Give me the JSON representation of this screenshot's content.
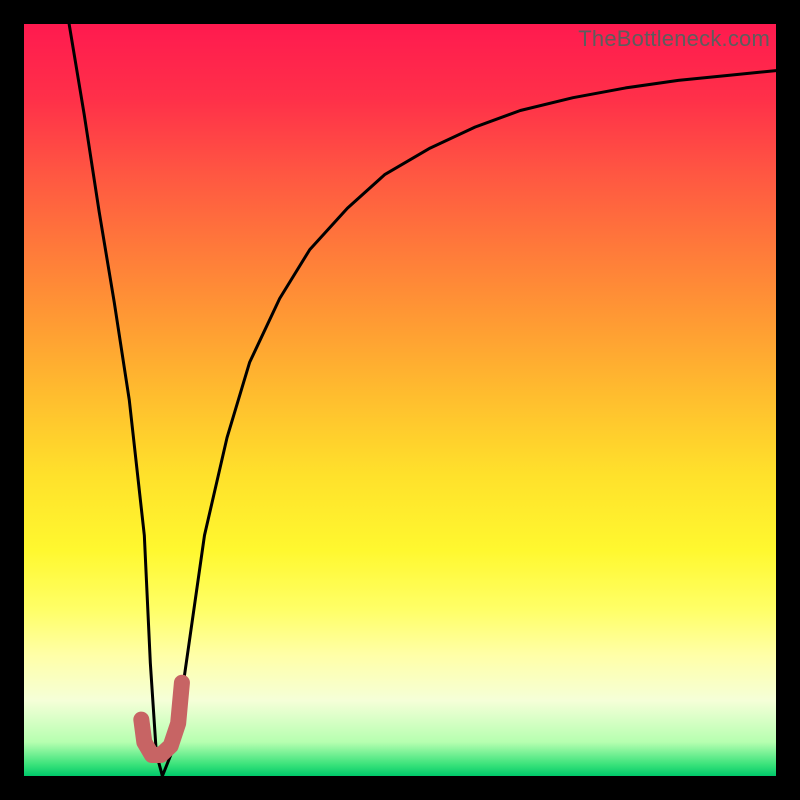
{
  "watermark": "TheBottleneck.com",
  "colors": {
    "frame": "#000000",
    "curve": "#000000",
    "marker": "#c76464",
    "gradient_stops": [
      {
        "o": 0.0,
        "c": "#ff1a4f"
      },
      {
        "o": 0.1,
        "c": "#ff3049"
      },
      {
        "o": 0.2,
        "c": "#ff5742"
      },
      {
        "o": 0.3,
        "c": "#ff7a3a"
      },
      {
        "o": 0.4,
        "c": "#ff9c33"
      },
      {
        "o": 0.5,
        "c": "#ffbf2e"
      },
      {
        "o": 0.6,
        "c": "#ffe12b"
      },
      {
        "o": 0.7,
        "c": "#fff82f"
      },
      {
        "o": 0.78,
        "c": "#ffff68"
      },
      {
        "o": 0.84,
        "c": "#ffffa8"
      },
      {
        "o": 0.9,
        "c": "#f5ffd8"
      },
      {
        "o": 0.955,
        "c": "#b6ffb0"
      },
      {
        "o": 0.985,
        "c": "#39e27a"
      },
      {
        "o": 1.0,
        "c": "#00c86a"
      }
    ]
  },
  "chart_data": {
    "type": "line",
    "title": "",
    "xlabel": "",
    "ylabel": "",
    "xlim": [
      0,
      100
    ],
    "ylim": [
      0,
      100
    ],
    "grid": false,
    "legend": false,
    "series": [
      {
        "name": "bottleneck-curve",
        "x": [
          6,
          8,
          10,
          12,
          14,
          16,
          16.8,
          17.6,
          18.4,
          20,
          22,
          24,
          27,
          30,
          34,
          38,
          43,
          48,
          54,
          60,
          66,
          73,
          80,
          87,
          94,
          100
        ],
        "y": [
          100,
          88,
          75,
          63,
          50,
          32,
          15,
          3,
          0,
          4,
          18,
          32,
          45,
          55,
          63.5,
          70,
          75.5,
          80,
          83.5,
          86.3,
          88.5,
          90.2,
          91.5,
          92.5,
          93.2,
          93.8
        ]
      }
    ],
    "marker": {
      "name": "optimum-j",
      "points": [
        {
          "x": 15.6,
          "y": 7.5
        },
        {
          "x": 16.0,
          "y": 4.5
        },
        {
          "x": 17.0,
          "y": 2.8
        },
        {
          "x": 18.2,
          "y": 2.8
        },
        {
          "x": 19.5,
          "y": 4.0
        },
        {
          "x": 20.5,
          "y": 7.0
        },
        {
          "x": 21.0,
          "y": 12.4
        }
      ]
    }
  }
}
